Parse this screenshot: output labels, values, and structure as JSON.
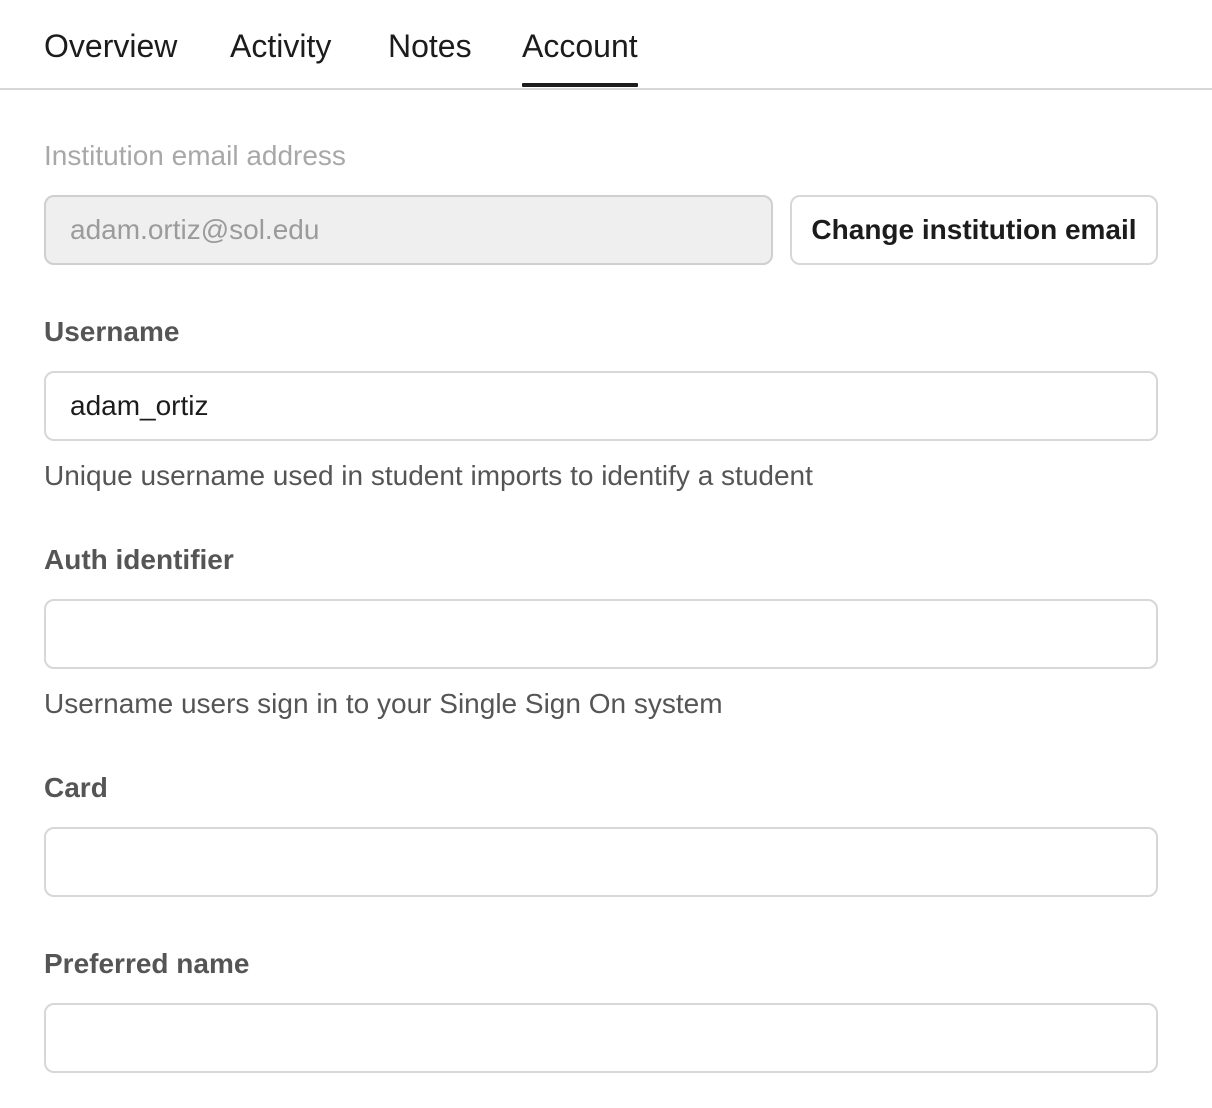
{
  "tabs": [
    {
      "label": "Overview"
    },
    {
      "label": "Activity"
    },
    {
      "label": "Notes"
    },
    {
      "label": "Account",
      "active": true
    }
  ],
  "form": {
    "institution_email": {
      "label": "Institution email address",
      "value": "adam.ortiz@sol.edu",
      "disabled": true,
      "button_label": "Change institution email"
    },
    "username": {
      "label": "Username",
      "value": "adam_ortiz",
      "help": "Unique username used in student imports to identify a student"
    },
    "auth_identifier": {
      "label": "Auth identifier",
      "value": "",
      "help": "Username users sign in to your Single Sign On system"
    },
    "card": {
      "label": "Card",
      "value": ""
    },
    "preferred_name": {
      "label": "Preferred name",
      "value": ""
    }
  }
}
